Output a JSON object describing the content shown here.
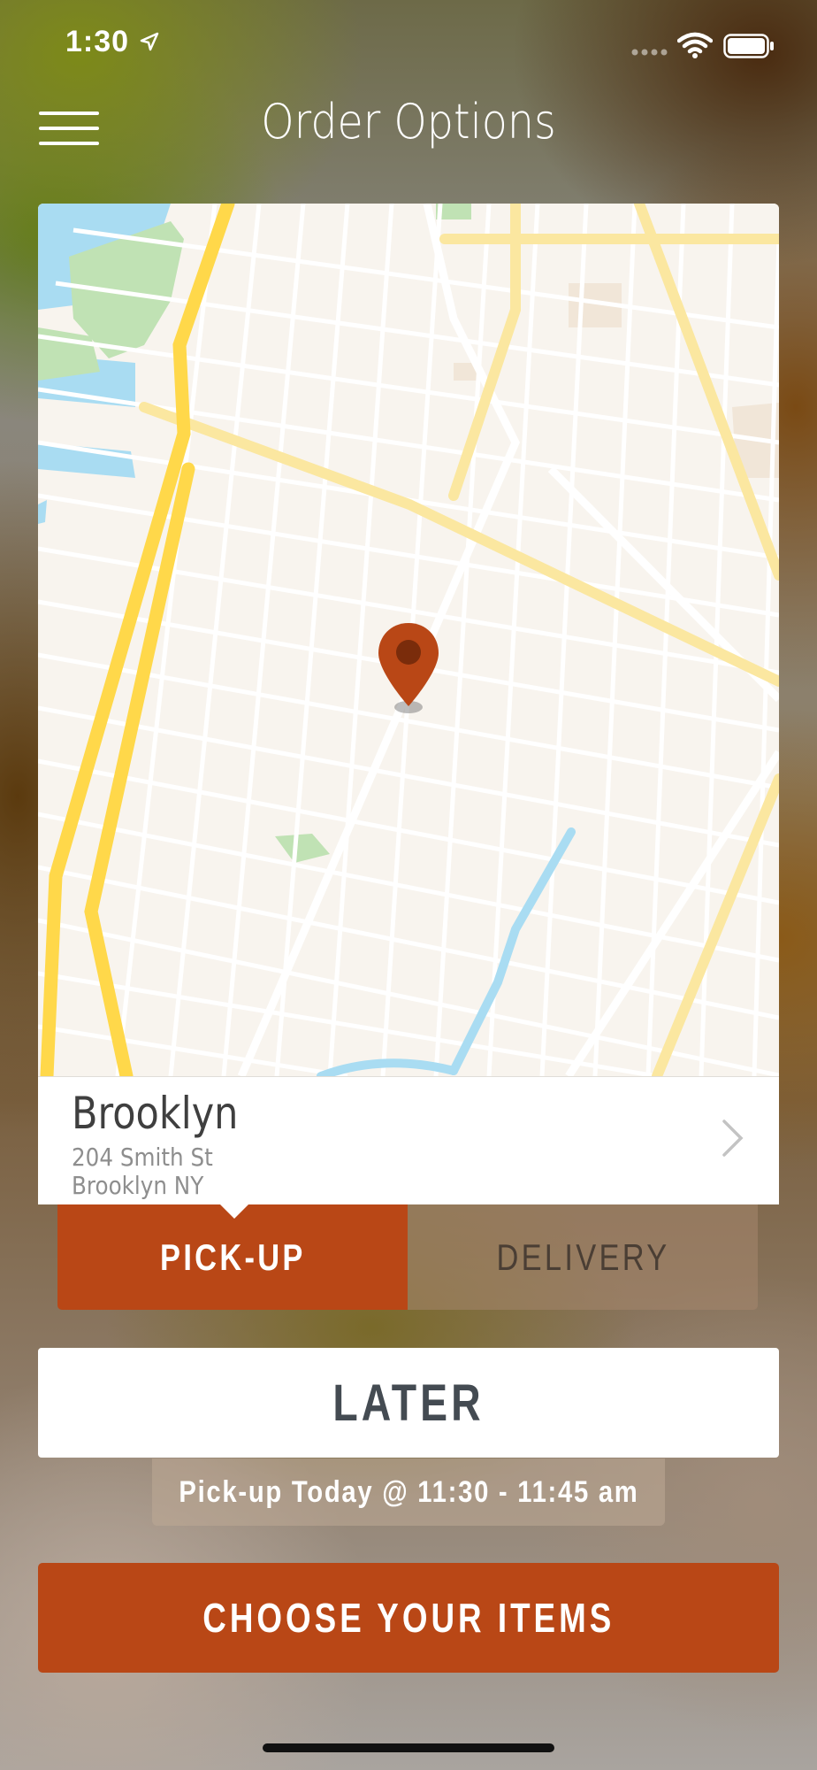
{
  "status_bar": {
    "time": "1:30",
    "icons": [
      "location-arrow-icon",
      "signal-dots-icon",
      "wifi-icon",
      "battery-icon"
    ]
  },
  "header": {
    "title": "Order Options",
    "menu_icon": "hamburger-menu-icon"
  },
  "map": {
    "pin_icon": "map-pin-icon",
    "pin_color": "#b94716"
  },
  "location": {
    "name": "Brooklyn",
    "address_line1": "204 Smith St",
    "address_line2": "Brooklyn NY",
    "chevron_icon": "chevron-right-icon"
  },
  "order_type": {
    "pickup_label": "PICK-UP",
    "delivery_label": "DELIVERY",
    "selected": "PICK-UP"
  },
  "timing": {
    "later_label": "LATER",
    "pickup_time_text": "Pick-up Today @ 11:30 - 11:45 am"
  },
  "cta": {
    "label": "CHOOSE YOUR ITEMS"
  },
  "colors": {
    "accent": "#b94716",
    "text_dark": "#444b52"
  }
}
